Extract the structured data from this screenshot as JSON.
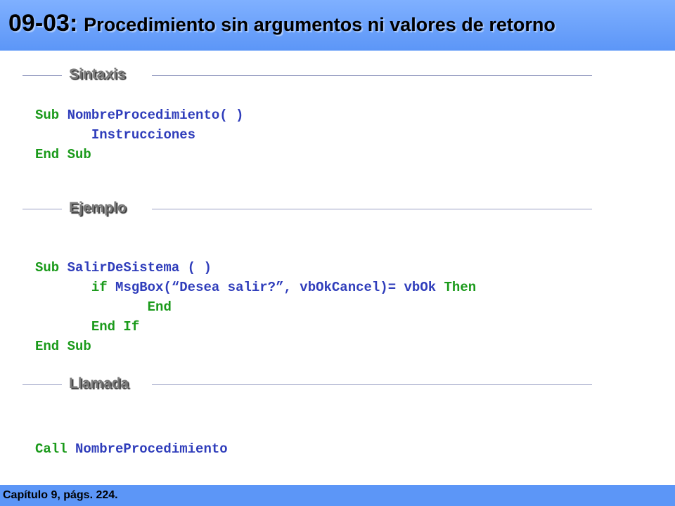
{
  "slide": {
    "title_number": "09-03:",
    "title_text": "Procedimiento sin argumentos ni valores de retorno"
  },
  "sections": {
    "syntax_label": "Sintaxis",
    "example_label": "Ejemplo",
    "call_label": "Llamada"
  },
  "syntax_code": {
    "line1_kw": "Sub ",
    "line1_name": "NombreProcedimiento( )",
    "line2": "Instrucciones",
    "line3": "End Sub"
  },
  "example_code": {
    "line1_kw": "Sub ",
    "line1_name": "SalirDeSistema",
    "line1_paren": " ( )",
    "line2_if": "if ",
    "line2_body": "MsgBox(“Desea salir?”, vbOkCancel)= vbOk ",
    "line2_then": "Then",
    "line3": "End",
    "line4": "End If",
    "line5": "End Sub"
  },
  "call_code": {
    "kw": "Call ",
    "name": "NombreProcedimiento"
  },
  "footer": {
    "text": "Capítulo 9, págs. 224."
  },
  "colors": {
    "header_bg": "#5c96f7",
    "keyword": "#1a9a1a",
    "text": "#2f3dbb"
  }
}
